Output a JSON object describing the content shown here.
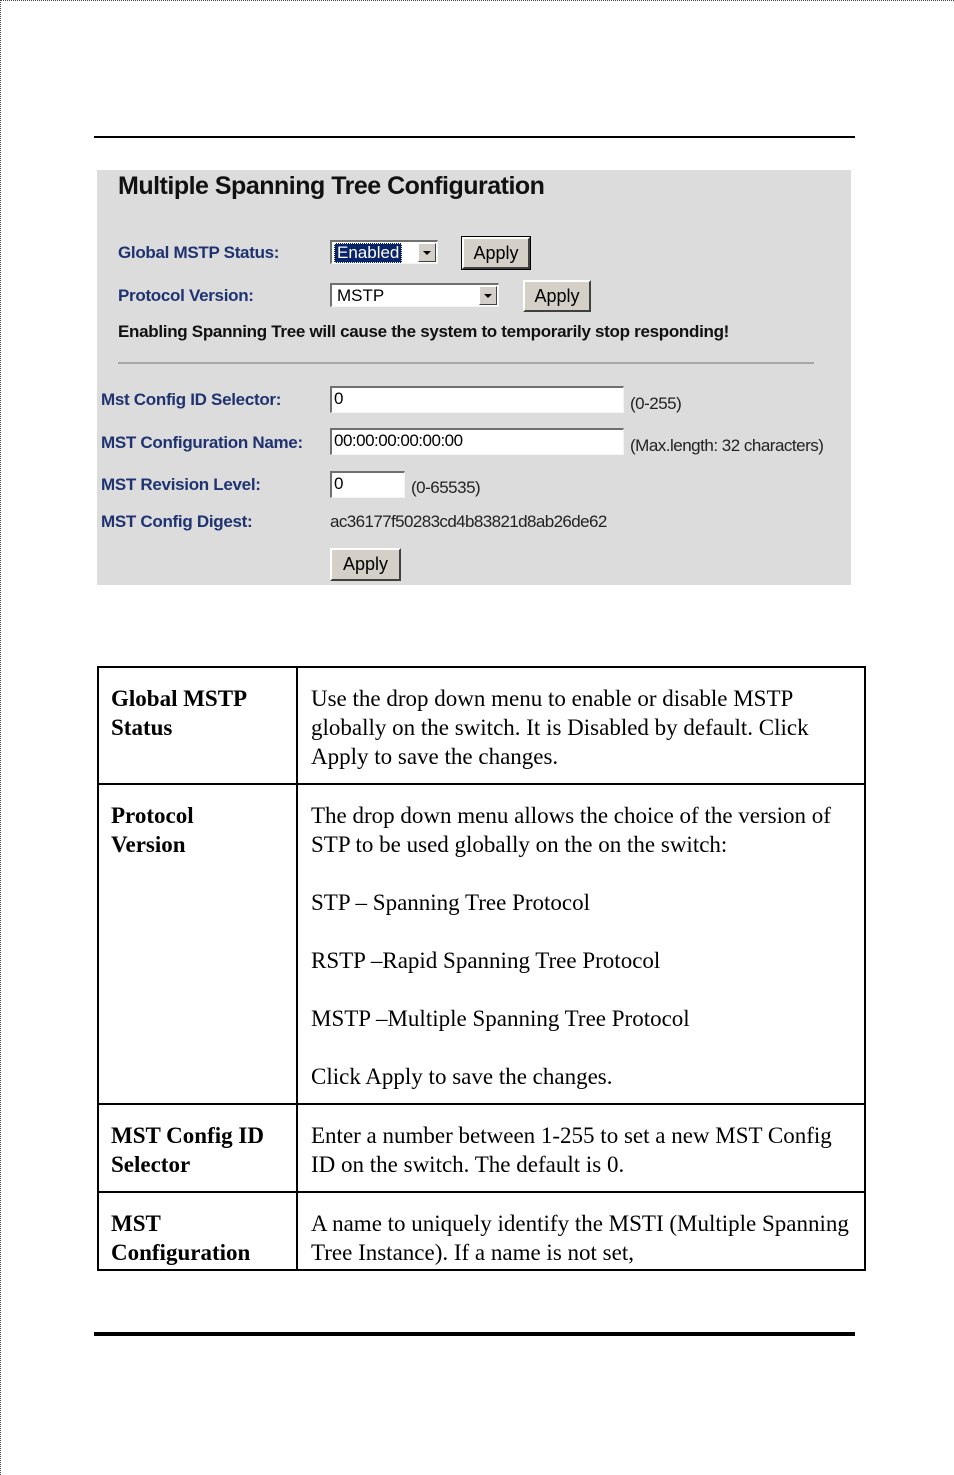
{
  "panel": {
    "title": "Multiple Spanning Tree Configuration",
    "global_status": {
      "label": "Global MSTP Status:",
      "selected": "Enabled",
      "apply_label": "Apply"
    },
    "protocol_version": {
      "label": "Protocol Version:",
      "selected": "MSTP",
      "apply_label": "Apply"
    },
    "warning": "Enabling Spanning Tree will cause the system to temporarily stop responding!",
    "config_id_selector": {
      "label": "Mst Config ID Selector:",
      "value": "0",
      "hint": "(0-255)"
    },
    "config_name": {
      "label": "MST Configuration Name:",
      "value": "00:00:00:00:00:00",
      "hint": "(Max.length: 32 characters)"
    },
    "revision_level": {
      "label": "MST Revision Level:",
      "value": "0",
      "hint": "(0-65535)"
    },
    "config_digest": {
      "label": "MST Config Digest:",
      "value": "ac36177f50283cd4b83821d8ab26de62"
    },
    "apply_label": "Apply"
  },
  "table": {
    "rows": [
      {
        "term": [
          "Global MSTP",
          "Status"
        ],
        "paragraphs": [
          "Use the drop down menu to enable or disable MSTP globally on the switch.  It is Disabled by default. Click Apply to save the changes."
        ]
      },
      {
        "term": [
          "Protocol",
          "Version"
        ],
        "paragraphs": [
          "The drop down menu allows the choice of the version of STP to be used globally on the on the switch:",
          "STP – Spanning Tree Protocol",
          "RSTP –Rapid Spanning Tree Protocol",
          "MSTP –Multiple Spanning Tree Protocol",
          "Click Apply to save the changes."
        ]
      },
      {
        "term": [
          "MST Config ID",
          "Selector"
        ],
        "paragraphs": [
          "Enter a number between 1-255 to set a new MST Config ID on the switch. The default is 0."
        ]
      },
      {
        "term": [
          "MST",
          "Configuration"
        ],
        "paragraphs": [
          "A name to uniquely identify the MSTI (Multiple Spanning Tree Instance).  If a name is not set,"
        ]
      }
    ]
  }
}
